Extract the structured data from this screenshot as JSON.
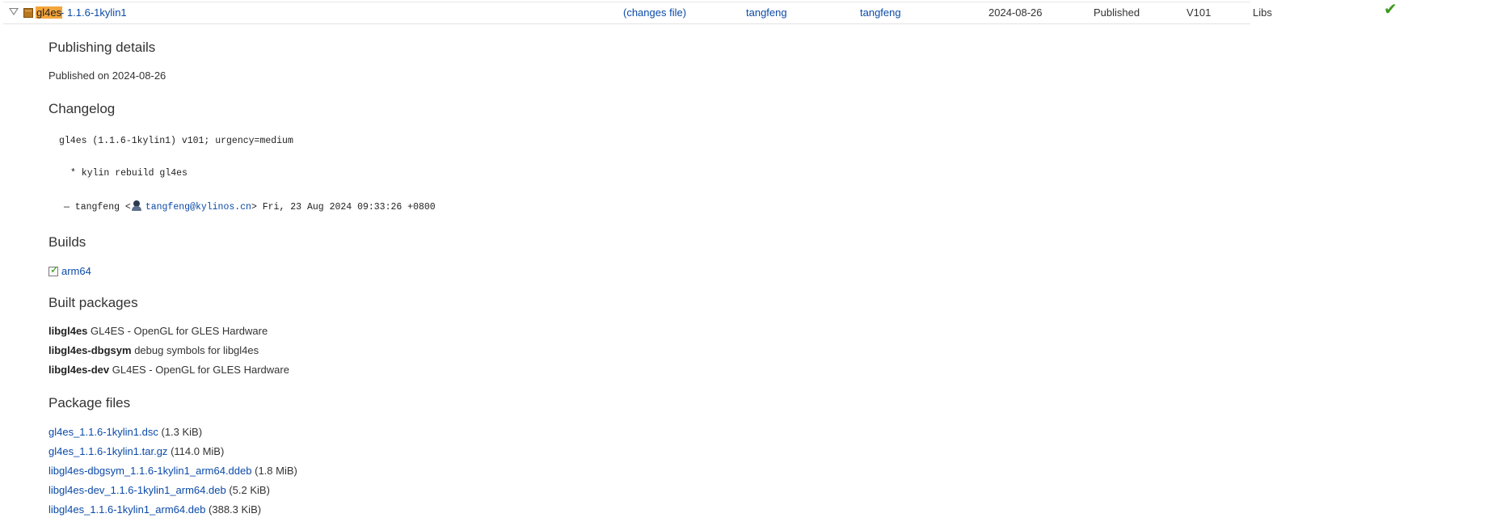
{
  "row": {
    "name": "gl4es",
    "version": "- 1.1.6-1kylin1",
    "changes_file": "(changes file)",
    "uploader": "tangfeng",
    "signer": "tangfeng",
    "date": "2024-08-26",
    "status": "Published",
    "series": "V101",
    "component": "Libs",
    "status_icon": "check-icon"
  },
  "publishing": {
    "heading": "Publishing details",
    "text": "Published on 2024-08-26"
  },
  "changelog": {
    "heading": "Changelog",
    "line1": "gl4es (1.1.6-1kylin1) v101; urgency=medium",
    "line2": "* kylin rebuild gl4es",
    "author_prefix": "— tangfeng <",
    "email": "tangfeng@kylinos.cn",
    "author_suffix": ">  Fri, 23 Aug 2024 09:33:26 +0800"
  },
  "builds": {
    "heading": "Builds",
    "items": [
      {
        "label": "arm64"
      }
    ]
  },
  "built_packages": {
    "heading": "Built packages",
    "items": [
      {
        "name": "libgl4es",
        "desc": "GL4ES - OpenGL for GLES Hardware"
      },
      {
        "name": "libgl4es-dbgsym",
        "desc": "debug symbols for libgl4es"
      },
      {
        "name": "libgl4es-dev",
        "desc": "GL4ES - OpenGL for GLES Hardware"
      }
    ]
  },
  "package_files": {
    "heading": "Package files",
    "items": [
      {
        "file": "gl4es_1.1.6-1kylin1.dsc",
        "size": "(1.3 KiB)"
      },
      {
        "file": "gl4es_1.1.6-1kylin1.tar.gz",
        "size": "(114.0 MiB)"
      },
      {
        "file": "libgl4es-dbgsym_1.1.6-1kylin1_arm64.ddeb",
        "size": "(1.8 MiB)"
      },
      {
        "file": "libgl4es-dev_1.1.6-1kylin1_arm64.deb",
        "size": "(5.2 KiB)"
      },
      {
        "file": "libgl4es_1.1.6-1kylin1_arm64.deb",
        "size": "(388.3 KiB)"
      }
    ]
  }
}
